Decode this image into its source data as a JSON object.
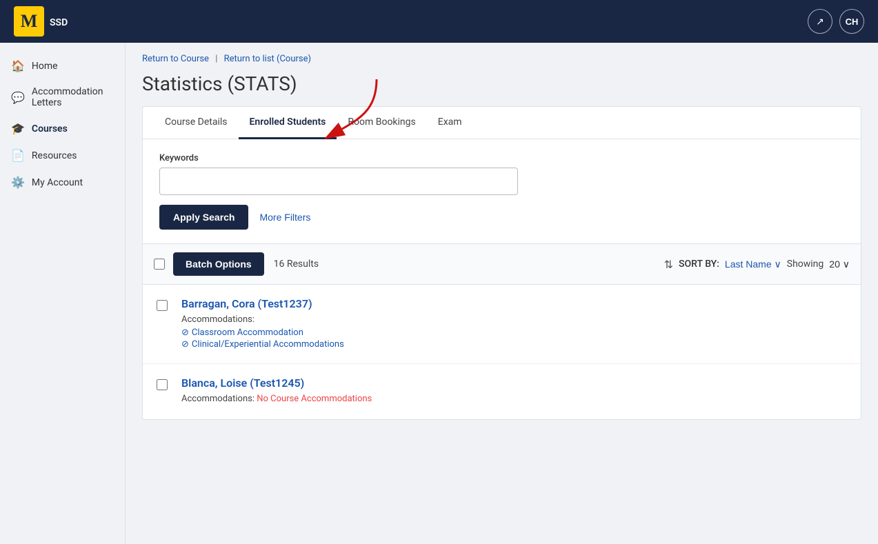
{
  "header": {
    "logo_letter": "M",
    "logo_subtitle": "SSD",
    "external_link_icon": "↗",
    "avatar_initials": "CH"
  },
  "sidebar": {
    "items": [
      {
        "id": "home",
        "icon": "🏠",
        "label": "Home"
      },
      {
        "id": "accommodation-letters",
        "icon": "💬",
        "label": "Accommodation Letters"
      },
      {
        "id": "courses",
        "icon": "🎓",
        "label": "Courses",
        "active": true
      },
      {
        "id": "resources",
        "icon": "📄",
        "label": "Resources"
      },
      {
        "id": "my-account",
        "icon": "⚙️",
        "label": "My Account"
      }
    ]
  },
  "breadcrumb": {
    "return_to_course": "Return to Course",
    "separator": "|",
    "return_to_list": "Return to list (Course)"
  },
  "page_title": "Statistics (STATS)",
  "tabs": [
    {
      "id": "course-details",
      "label": "Course Details",
      "active": false
    },
    {
      "id": "enrolled-students",
      "label": "Enrolled Students",
      "active": true
    },
    {
      "id": "room-bookings",
      "label": "Room Bookings",
      "active": false
    },
    {
      "id": "exam",
      "label": "Exam",
      "active": false
    }
  ],
  "search": {
    "keywords_label": "Keywords",
    "keywords_placeholder": "",
    "apply_search_label": "Apply Search",
    "more_filters_label": "More Filters"
  },
  "list_controls": {
    "batch_options_label": "Batch Options",
    "results_count": "16 Results",
    "sort_by_label": "SORT BY:",
    "sort_option": "Last Name",
    "showing_label": "Showing",
    "showing_value": "20"
  },
  "students": [
    {
      "id": "student1",
      "name": "Barragan, Cora (Test1237)",
      "accommodations_label": "Accommodations:",
      "accommodations": [
        {
          "type": "link",
          "text": "Classroom Accommodation"
        },
        {
          "type": "link",
          "text": "Clinical/Experiential Accommodations"
        }
      ]
    },
    {
      "id": "student2",
      "name": "Blanca, Loise (Test1245)",
      "accommodations_label": "Accommodations:",
      "accommodations": [
        {
          "type": "no-accommodation",
          "text": "No Course Accommodations"
        }
      ]
    }
  ]
}
